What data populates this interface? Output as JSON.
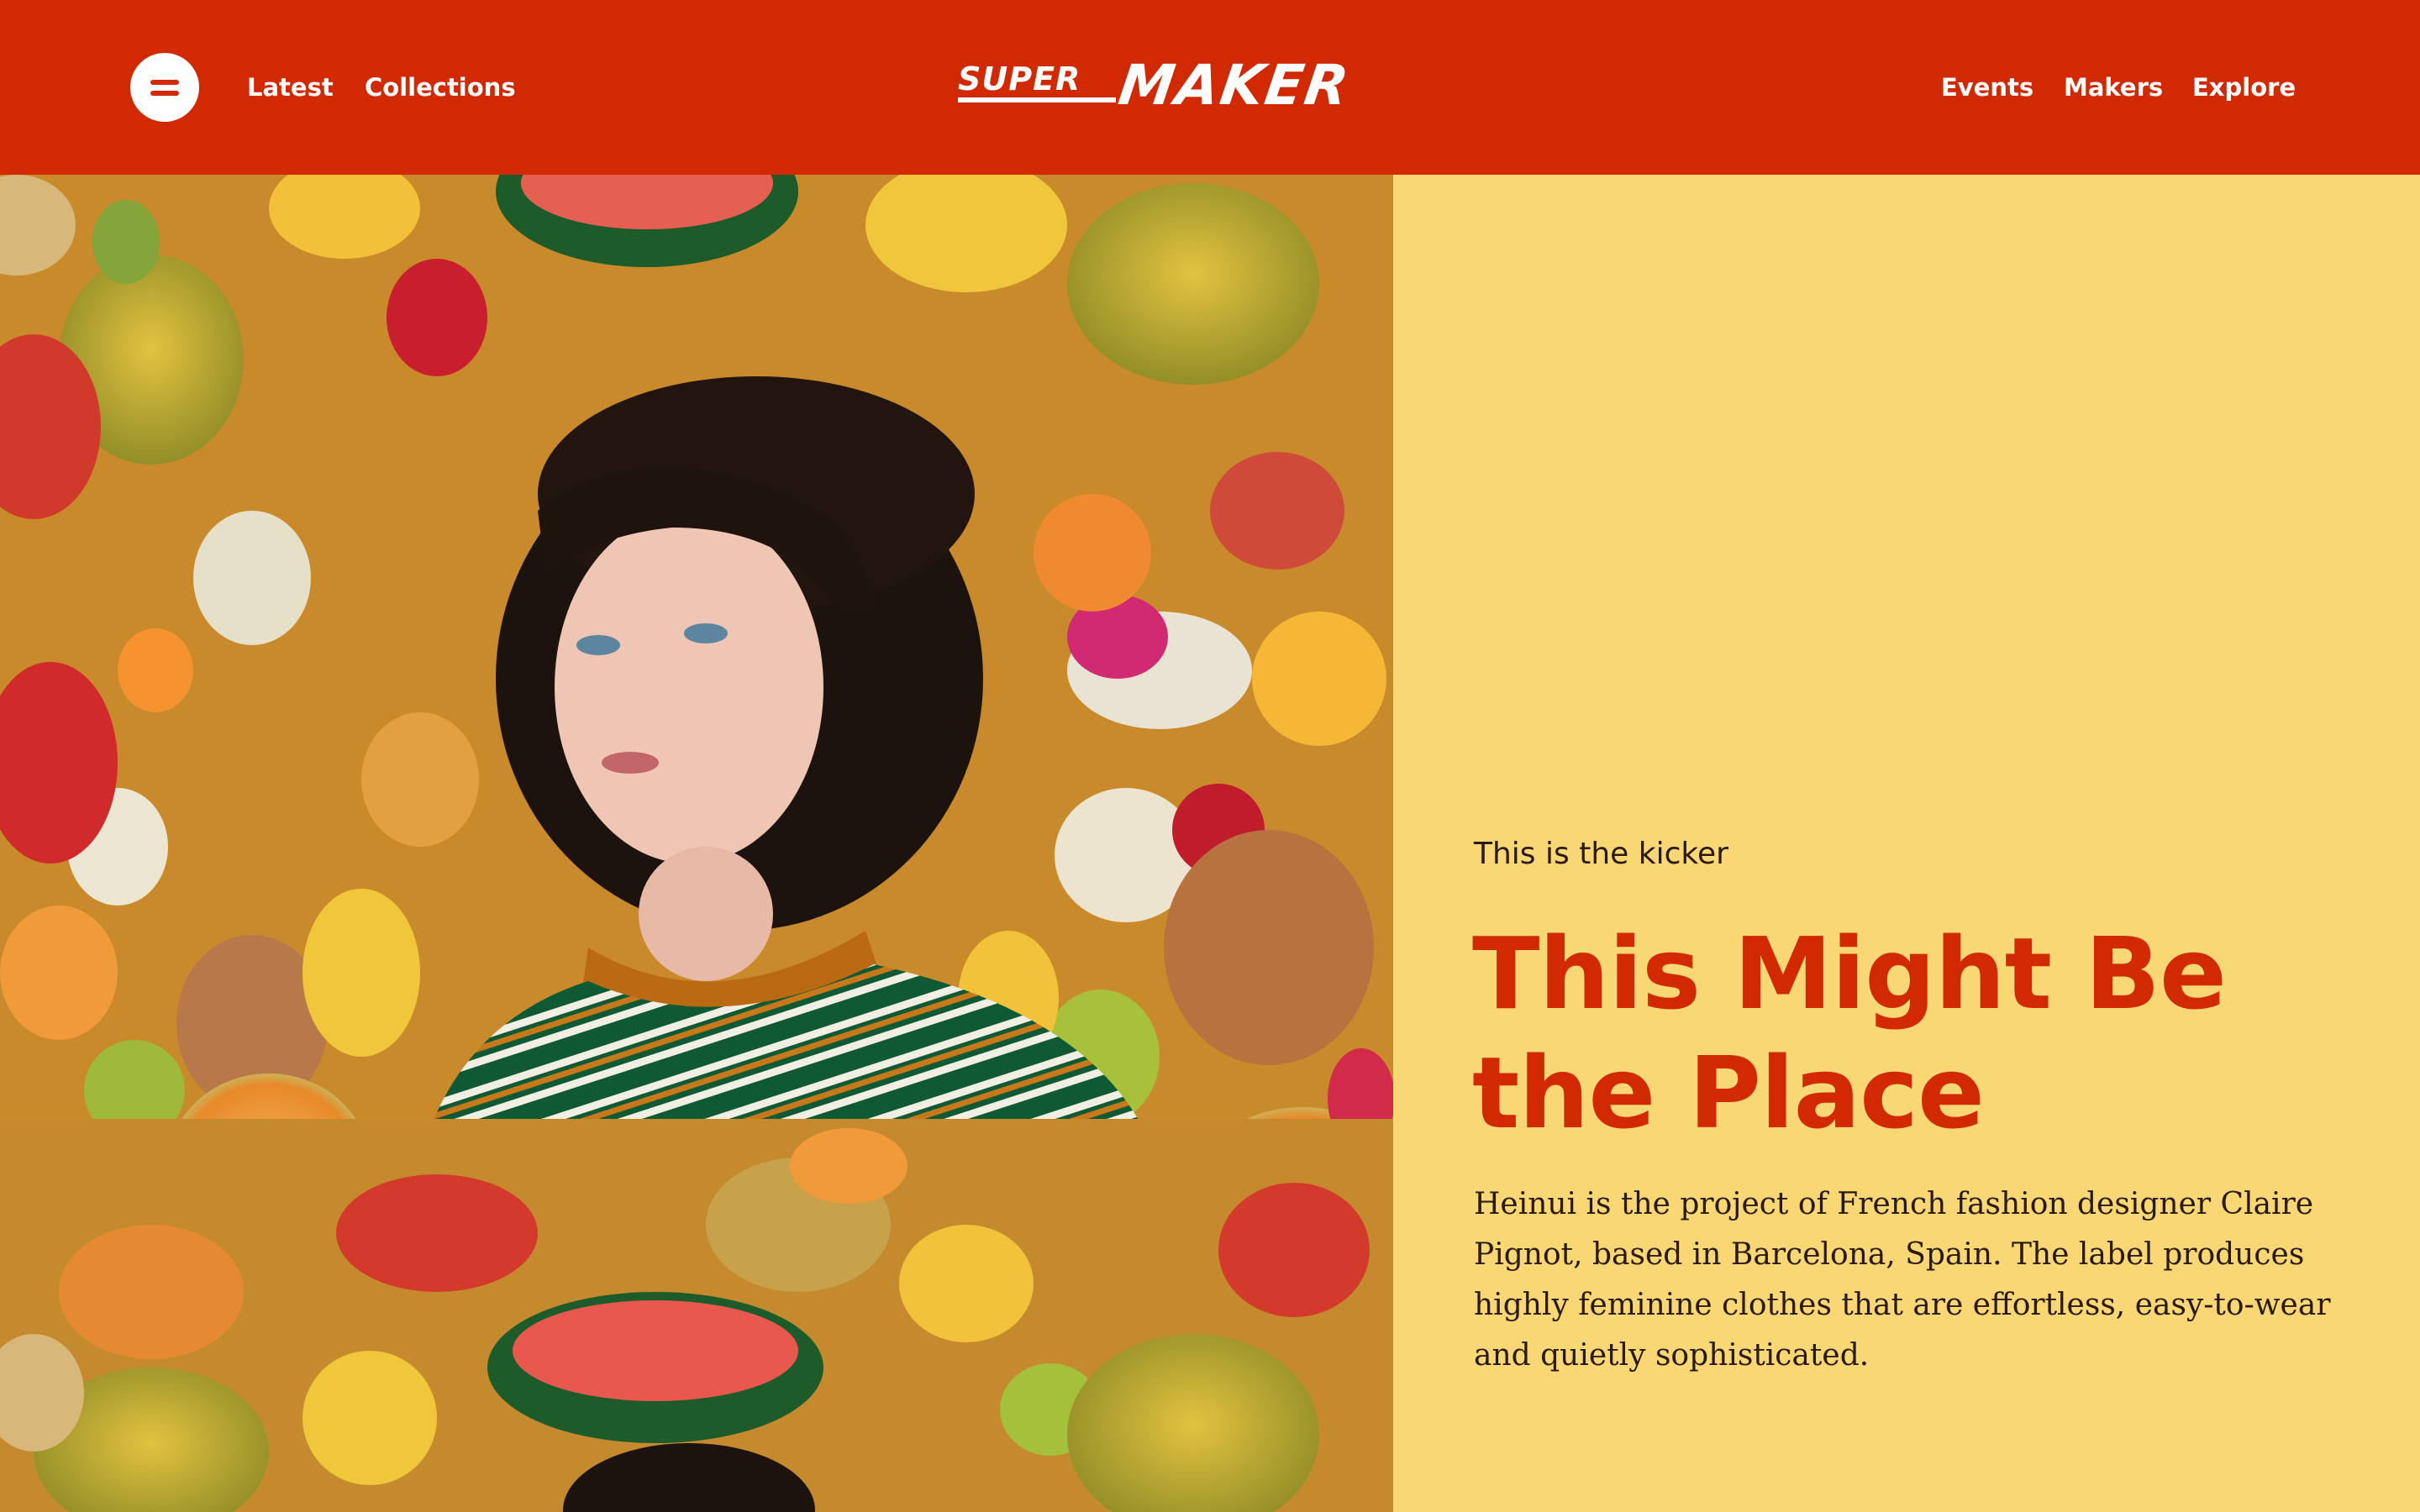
{
  "header": {
    "background_color": "#d12a02",
    "menu_icon": "hamburger-menu-icon",
    "nav_left": [
      {
        "label": "Latest"
      },
      {
        "label": "Collections"
      }
    ],
    "logo": {
      "part1": "SUPER",
      "part2": "MAKER"
    },
    "nav_right": [
      {
        "label": "Events"
      },
      {
        "label": "Makers"
      },
      {
        "label": "Explore"
      }
    ]
  },
  "hero": {
    "image_description": "Portrait of a woman in a green striped top against a collage of tropical fruit"
  },
  "article": {
    "kicker": "This is the kicker",
    "headline": "This Might Be the Place",
    "body": "Heinui is the project of French fashion designer Claire Pignot, based in Barcelona, Spain. The label produces highly feminine clothes that are effortless, easy-to-wear and quietly sophisticated.",
    "panel_color": "#f8d774",
    "headline_color": "#d12a02"
  }
}
